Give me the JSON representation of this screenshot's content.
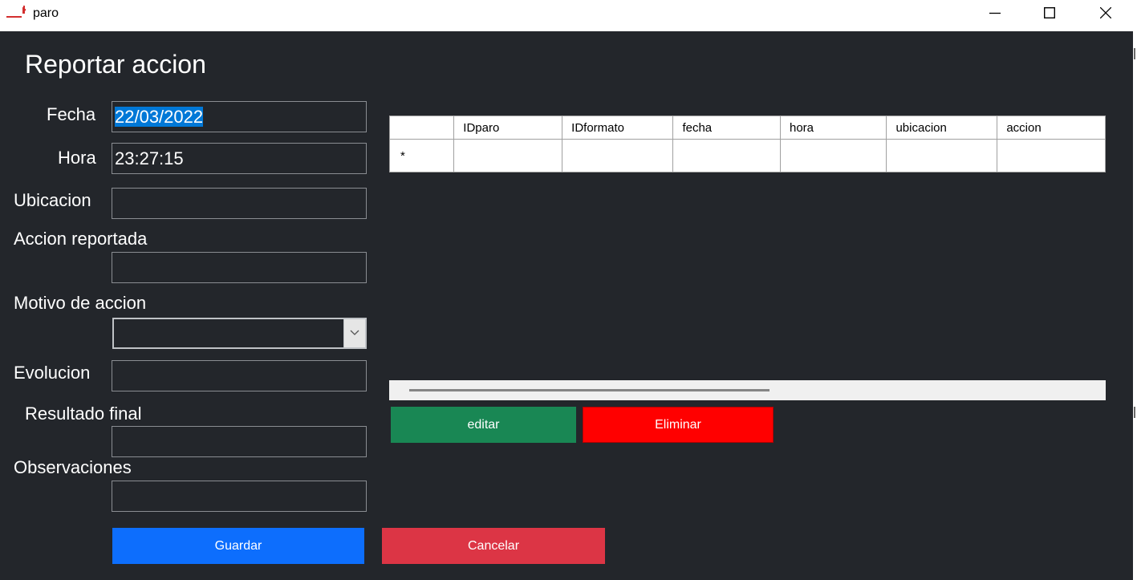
{
  "window": {
    "title": "paro",
    "minimize_icon": "minimize-icon",
    "maximize_icon": "maximize-icon",
    "close_icon": "close-icon"
  },
  "form": {
    "heading": "Reportar accion",
    "fecha": {
      "label": "Fecha",
      "value": "22/03/2022"
    },
    "hora": {
      "label": "Hora",
      "value": "23:27:15"
    },
    "ubicacion": {
      "label": "Ubicacion",
      "value": ""
    },
    "accion_reportada": {
      "label": "Accion reportada",
      "value": ""
    },
    "motivo": {
      "label": "Motivo de accion",
      "value": ""
    },
    "evolucion": {
      "label": "Evolucion",
      "value": ""
    },
    "resultado_final": {
      "label": "Resultado final",
      "value": ""
    },
    "observaciones": {
      "label": "Observaciones",
      "value": ""
    }
  },
  "grid": {
    "columns": [
      "IDparo",
      "IDformato",
      "fecha",
      "hora",
      "ubicacion",
      "accion"
    ],
    "new_row_marker": "*"
  },
  "actions": {
    "editar": "editar",
    "eliminar": "Eliminar",
    "guardar": "Guardar",
    "cancelar": "Cancelar"
  },
  "colors": {
    "background": "#23262b",
    "editar": "#198754",
    "eliminar": "#ff0000",
    "guardar": "#0d6efd",
    "cancelar": "#dc3545",
    "selection": "#0078d7"
  }
}
